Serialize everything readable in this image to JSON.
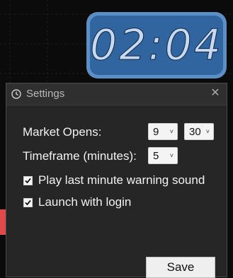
{
  "clock": {
    "time": "02:04"
  },
  "dialog": {
    "title": "Settings",
    "market_opens_label": "Market Opens:",
    "market_open_hour": "9",
    "market_open_minute": "30",
    "timeframe_label": "Timeframe (minutes):",
    "timeframe_value": "5",
    "warning_sound_label": "Play last minute warning sound",
    "warning_sound_checked": true,
    "launch_login_label": "Launch with login",
    "launch_login_checked": true,
    "save_label": "Save"
  },
  "icons": {
    "title": "clock-icon",
    "close": "close-icon",
    "dropdown": "chevron-down-icon",
    "check": "checkmark-icon"
  },
  "colors": {
    "clock_face": "#31659f",
    "clock_border": "#5d8ec4",
    "dialog_bg": "#262626",
    "accent_red": "#e04a4a"
  }
}
